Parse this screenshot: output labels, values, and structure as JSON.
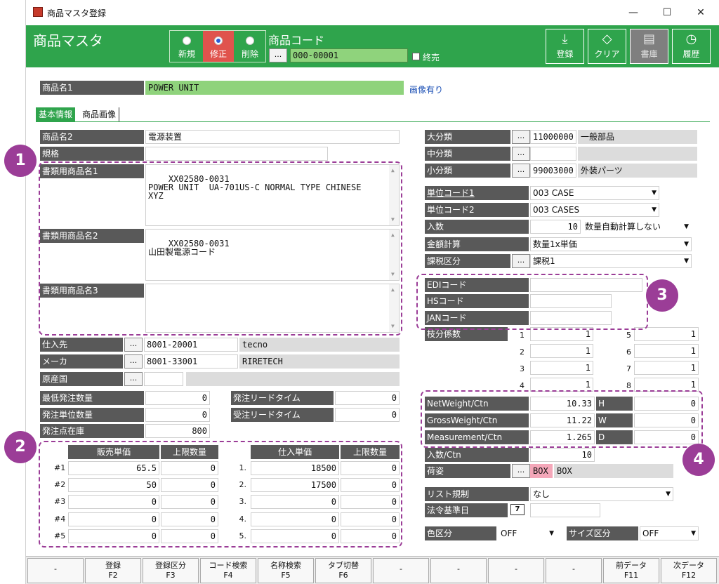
{
  "window": {
    "title": "商品マスタ登録",
    "min": "—",
    "max": "☐",
    "close": "✕"
  },
  "header": {
    "app_name": "商品マスタ",
    "modes": [
      {
        "label": "新規",
        "selected": false
      },
      {
        "label": "修正",
        "selected": true
      },
      {
        "label": "削除",
        "selected": false
      }
    ],
    "code_label": "商品コード",
    "lookup": "...",
    "code_value": "000-00001",
    "discontinued_label": "終売",
    "toolbar": [
      {
        "label": "登録",
        "icon": "download-icon",
        "glyph": "⤓"
      },
      {
        "label": "クリア",
        "icon": "eraser-icon",
        "glyph": "◇"
      },
      {
        "label": "書庫",
        "icon": "archive-icon",
        "glyph": "▤"
      },
      {
        "label": "履歴",
        "icon": "history-icon",
        "glyph": "◷"
      }
    ]
  },
  "product_name1": {
    "label": "商品名1",
    "value": "POWER UNIT",
    "image_link": "画像有り"
  },
  "tabs": [
    "基本情報",
    "商品画像"
  ],
  "left": {
    "name2": {
      "label": "商品名2",
      "value": "電源装置"
    },
    "spec": {
      "label": "規格",
      "value": ""
    },
    "doc_name1": {
      "label": "書類用商品名1",
      "value": "XX02580-0031\nPOWER UNIT  UA-701US-C NORMAL TYPE CHINESE\nXYZ"
    },
    "doc_name2": {
      "label": "書類用商品名2",
      "value": "XX02580-0031\n山田製電源コード"
    },
    "doc_name3": {
      "label": "書類用商品名3",
      "value": ""
    },
    "supplier": {
      "label": "仕入先",
      "code": "8001-20001",
      "name": "tecno"
    },
    "maker": {
      "label": "メーカ",
      "code": "8001-33001",
      "name": "RIRETECH"
    },
    "origin": {
      "label": "原産国",
      "code": "",
      "name": ""
    },
    "min_order": {
      "label": "最低発注数量",
      "value": "0"
    },
    "order_unit": {
      "label": "発注単位数量",
      "value": "0"
    },
    "reorder_point": {
      "label": "発注点在庫",
      "value": "800"
    },
    "order_lead": {
      "label": "発注リードタイム",
      "value": "0"
    },
    "receive_lead": {
      "label": "受注リードタイム",
      "value": "0"
    }
  },
  "price_table": {
    "sales_headers": [
      "販売単価",
      "上限数量"
    ],
    "purchase_headers": [
      "仕入単価",
      "上限数量"
    ],
    "sales_rows": [
      {
        "no": "#1",
        "price": "65.5",
        "limit": "0"
      },
      {
        "no": "#2",
        "price": "50",
        "limit": "0"
      },
      {
        "no": "#3",
        "price": "0",
        "limit": "0"
      },
      {
        "no": "#4",
        "price": "0",
        "limit": "0"
      },
      {
        "no": "#5",
        "price": "0",
        "limit": "0"
      }
    ],
    "purchase_rows": [
      {
        "no": "1.",
        "price": "18500",
        "limit": "0"
      },
      {
        "no": "2.",
        "price": "17500",
        "limit": "0"
      },
      {
        "no": "3.",
        "price": "0",
        "limit": "0"
      },
      {
        "no": "4.",
        "price": "0",
        "limit": "0"
      },
      {
        "no": "5.",
        "price": "0",
        "limit": "0"
      }
    ]
  },
  "right": {
    "major": {
      "label": "大分類",
      "code": "11000000",
      "name": "一般部品"
    },
    "middle": {
      "label": "中分類",
      "code": "",
      "name": ""
    },
    "minor": {
      "label": "小分類",
      "code": "99003000",
      "name": "外装パーツ"
    },
    "unit1": {
      "label": "単位コード1",
      "value": "003 CASE"
    },
    "unit2": {
      "label": "単位コード2",
      "value": "003 CASES"
    },
    "qty": {
      "label": "入数",
      "value": "10",
      "calc": "数量自動計算しない"
    },
    "amount_calc": {
      "label": "金額計算",
      "value": "数量1x単価"
    },
    "tax": {
      "label": "課税区分",
      "value": "課税1"
    },
    "edi": {
      "label": "EDIコード",
      "value": ""
    },
    "hs": {
      "label": "HSコード",
      "value": ""
    },
    "jan": {
      "label": "JANコード",
      "value": ""
    },
    "branch": {
      "label": "枝分係数",
      "rows": [
        {
          "n": "1",
          "v": "1",
          "n2": "5",
          "v2": "1"
        },
        {
          "n": "2",
          "v": "1",
          "n2": "6",
          "v2": "1"
        },
        {
          "n": "3",
          "v": "1",
          "n2": "7",
          "v2": "1"
        },
        {
          "n": "4",
          "v": "1",
          "n2": "8",
          "v2": "1"
        }
      ]
    },
    "net": {
      "label": "NetWeight/Ctn",
      "value": "10.33",
      "dim_label": "H",
      "dim": "0"
    },
    "gross": {
      "label": "GrossWeight/Ctn",
      "value": "11.22",
      "dim_label": "W",
      "dim": "0"
    },
    "meas": {
      "label": "Measurement/Ctn",
      "value": "1.265",
      "dim_label": "D",
      "dim": "0"
    },
    "qty_ctn": {
      "label": "入数/Ctn",
      "value": "10"
    },
    "packing": {
      "label": "荷姿",
      "code": "BOX",
      "name": "BOX"
    },
    "list_reg": {
      "label": "リスト規制",
      "value": "なし"
    },
    "law_date": {
      "label": "法令基準日",
      "value": ""
    },
    "color": {
      "label": "色区分",
      "value": "OFF"
    },
    "size": {
      "label": "サイズ区分",
      "value": "OFF"
    }
  },
  "badges": [
    "1",
    "2",
    "3",
    "4"
  ],
  "fkeys": [
    {
      "top": "-",
      "bottom": ""
    },
    {
      "top": "登録",
      "bottom": "F2"
    },
    {
      "top": "登録区分",
      "bottom": "F3"
    },
    {
      "top": "コード検索",
      "bottom": "F4"
    },
    {
      "top": "名称検索",
      "bottom": "F5"
    },
    {
      "top": "タブ切替",
      "bottom": "F6"
    },
    {
      "top": "-",
      "bottom": ""
    },
    {
      "top": "-",
      "bottom": ""
    },
    {
      "top": "-",
      "bottom": ""
    },
    {
      "top": "-",
      "bottom": ""
    },
    {
      "top": "前データ",
      "bottom": "F11"
    },
    {
      "top": "次データ",
      "bottom": "F12"
    }
  ],
  "colors": {
    "header": "#2fa44c",
    "label": "#595959",
    "accent": "#9b3d97",
    "selected_mode": "#e0534d"
  }
}
